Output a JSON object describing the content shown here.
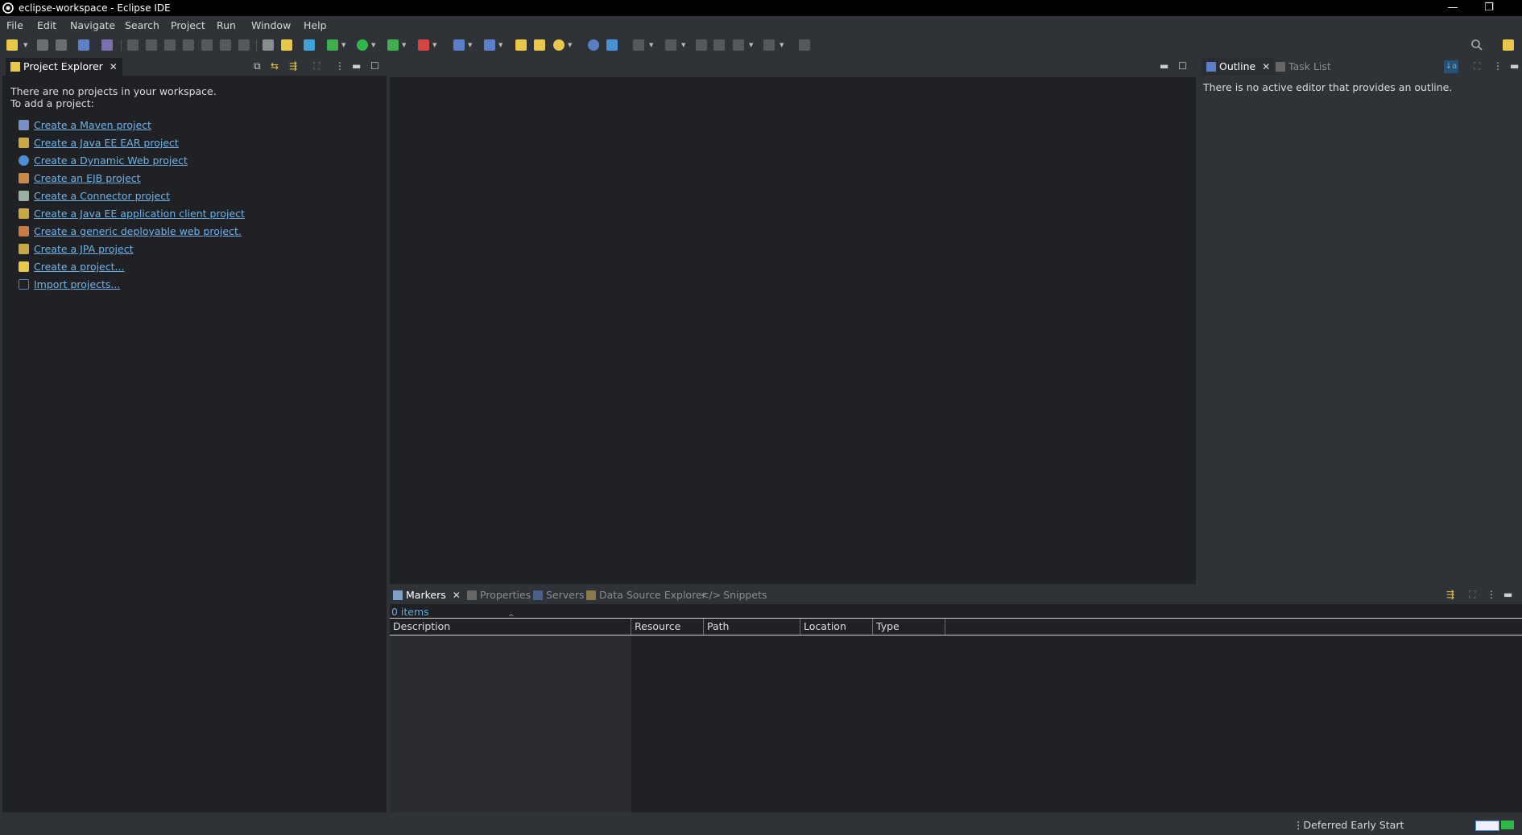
{
  "window": {
    "title": "eclipse-workspace - Eclipse IDE",
    "minimize": "—",
    "restore": "❐"
  },
  "menu": [
    "File",
    "Edit",
    "Navigate",
    "Search",
    "Project",
    "Run",
    "Window",
    "Help"
  ],
  "project_explorer": {
    "tab_label": "Project Explorer",
    "empty_line1": "There are no projects in your workspace.",
    "empty_line2": "To add a project:",
    "links": [
      "Create a Maven project",
      "Create a Java EE EAR project",
      "Create a Dynamic Web project",
      "Create an EJB project",
      "Create a Connector project",
      "Create a Java EE application client project",
      "Create a generic deployable web project.",
      "Create a JPA project",
      "Create a project...",
      "Import projects..."
    ]
  },
  "outline": {
    "tab_label": "Outline",
    "other_tab": "Task List",
    "message": "There is no active editor that provides an outline."
  },
  "bottom": {
    "tabs": [
      "Markers",
      "Properties",
      "Servers",
      "Data Source Explorer",
      "Snippets"
    ],
    "item_count": "0 items",
    "columns": [
      "Description",
      "Resource",
      "Path",
      "Location",
      "Type"
    ]
  },
  "status": {
    "text": "Deferred Early Start"
  },
  "colors": {
    "accent": "#6fb3e8",
    "panel": "#1f2124",
    "chrome": "#2f3237"
  }
}
